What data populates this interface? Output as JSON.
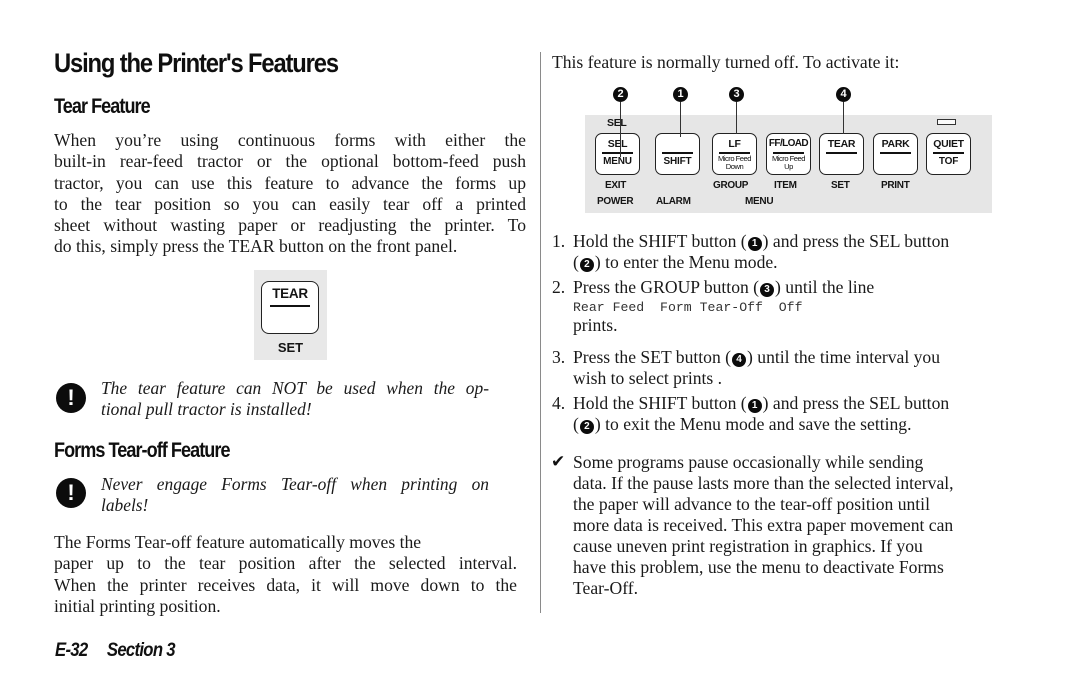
{
  "page": {
    "title": "Using the Printer's Features",
    "footer": {
      "page_number": "E-32",
      "section": "Section 3"
    }
  },
  "left_column": {
    "tear_feature": {
      "heading": "Tear Feature",
      "paragraph_lines": [
        "When you’re using continuous forms with either the",
        "built-in rear-feed tractor or the optional bottom-feed push",
        "tractor, you can use this feature to advance the forms up",
        "to the tear position so you can easily tear off a printed",
        "sheet without wasting paper or readjusting the printer. To",
        "do this, simply press the TEAR button on the front panel."
      ],
      "illustration": {
        "key_label": "TEAR",
        "under_label": "SET"
      },
      "warning": {
        "icon": "exclamation-icon",
        "lines": [
          "The tear feature can NOT be used when the op-",
          "tional pull tractor is installed!"
        ]
      }
    },
    "forms_tearoff": {
      "heading": "Forms Tear-off Feature",
      "warning": {
        "icon": "exclamation-icon",
        "lines": [
          "Never engage Forms Tear-off when printing on",
          "labels!"
        ]
      },
      "paragraph_lines": [
        "The Forms Tear-off feature automatically moves the",
        "paper up to the tear position after the selected interval.",
        "When the printer receives data, it will move down to the",
        "initial printing position."
      ]
    }
  },
  "right_column": {
    "intro": "This feature is normally turned off. To activate it:",
    "panel": {
      "callouts": [
        "❷",
        "❶",
        "❸",
        "❹"
      ],
      "callout_numbers": [
        "2",
        "1",
        "3",
        "4"
      ],
      "sel_top_label": "SEL",
      "keys": [
        {
          "top": "SEL",
          "bottom": "MENU",
          "under": "EXIT"
        },
        {
          "top": "",
          "bottom": "SHIFT",
          "under": ""
        },
        {
          "top": "LF",
          "bottom_small_1": "Micro Feed",
          "bottom_small_2": "Down",
          "under": "GROUP"
        },
        {
          "top": "FF/LOAD",
          "bottom_small_1": "Micro Feed",
          "bottom_small_2": "Up",
          "under": "ITEM"
        },
        {
          "top": "TEAR",
          "bottom": "",
          "under": "SET"
        },
        {
          "top": "PARK",
          "bottom": "",
          "under": "PRINT"
        },
        {
          "top": "QUIET",
          "bottom": "TOF",
          "under": ""
        }
      ],
      "bottom_labels": {
        "power": "POWER",
        "alarm": "ALARM",
        "menu": "MENU"
      }
    },
    "steps": [
      {
        "num": "1.",
        "lines": [
          "Hold the SHIFT button (",
          ") and press the SEL button",
          "(",
          ") to enter the Menu mode."
        ],
        "refs": [
          "1",
          "2"
        ]
      },
      {
        "num": "2.",
        "line1_a": "Press the GROUP button (",
        "line1_b": ") until the line",
        "ref": "3",
        "code": "Rear Feed  Form Tear-Off  Off",
        "line3": "prints."
      },
      {
        "num": "3.",
        "line1_a": "Press the SET button (",
        "line1_b": ") until the time interval you",
        "ref": "4",
        "line2": "wish to select prints ."
      },
      {
        "num": "4.",
        "lines": [
          "Hold the SHIFT button (",
          ") and press the SEL button",
          "(",
          ") to exit the Menu mode and save the setting."
        ],
        "refs": [
          "1",
          "2"
        ]
      }
    ],
    "tip": {
      "icon": "checkmark-icon",
      "glyph": "✔",
      "lines": [
        "Some programs pause occasionally while sending",
        "data. If the pause lasts more than the selected interval,",
        "the paper will advance to the tear-off position until",
        "more data is received. This extra paper movement can",
        "cause uneven print registration in graphics. If you",
        "have this problem, use the menu to deactivate Forms",
        "Tear-Off."
      ]
    }
  }
}
